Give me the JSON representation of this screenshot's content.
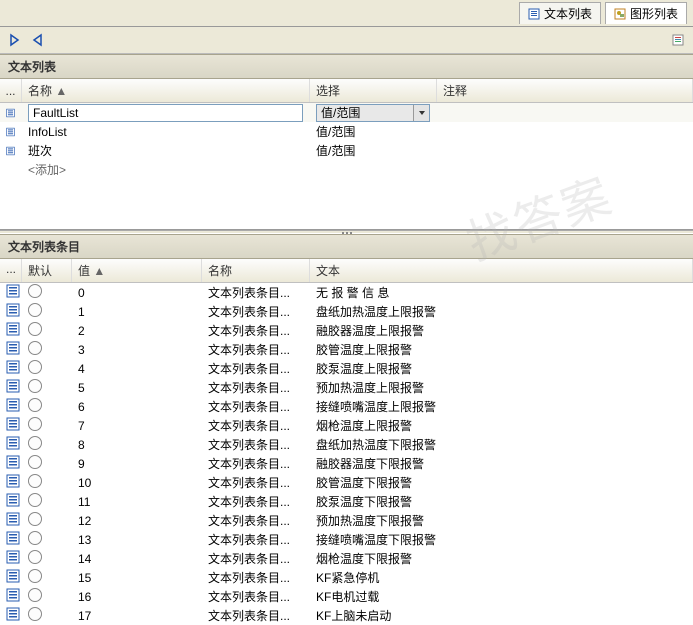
{
  "tabs": {
    "text_list": "文本列表",
    "graphic_list": "图形列表"
  },
  "section_list": {
    "title": "文本列表",
    "cols": {
      "name": "名称",
      "sel": "选择",
      "note": "注释"
    },
    "option": "值/范围",
    "rows": [
      {
        "name": "FaultList",
        "sel": "值/范围",
        "editing": true
      },
      {
        "name": "InfoList",
        "sel": "值/范围"
      },
      {
        "name": "班次",
        "sel": "值/范围"
      }
    ],
    "add": "<添加>"
  },
  "section_entries": {
    "title": "文本列表条目",
    "cols": {
      "def": "默认",
      "val": "值",
      "name": "名称",
      "text": "文本"
    },
    "rows": [
      {
        "val": "0",
        "name": "文本列表条目...",
        "text": "无  报  警  信  息"
      },
      {
        "val": "1",
        "name": "文本列表条目...",
        "text": "  盘纸加热温度上限报警"
      },
      {
        "val": "2",
        "name": "文本列表条目...",
        "text": "融胶器温度上限报警"
      },
      {
        "val": "3",
        "name": "文本列表条目...",
        "text": "胶管温度上限报警"
      },
      {
        "val": "4",
        "name": "文本列表条目...",
        "text": "胶泵温度上限报警"
      },
      {
        "val": "5",
        "name": "文本列表条目...",
        "text": "预加热温度上限报警"
      },
      {
        "val": "6",
        "name": "文本列表条目...",
        "text": "接缝喷嘴温度上限报警"
      },
      {
        "val": "7",
        "name": "文本列表条目...",
        "text": "烟枪温度上限报警"
      },
      {
        "val": "8",
        "name": "文本列表条目...",
        "text": "  盘纸加热温度下限报警"
      },
      {
        "val": "9",
        "name": "文本列表条目...",
        "text": "融胶器温度下限报警"
      },
      {
        "val": "10",
        "name": "文本列表条目...",
        "text": "胶管温度下限报警"
      },
      {
        "val": "11",
        "name": "文本列表条目...",
        "text": "胶泵温度下限报警"
      },
      {
        "val": "12",
        "name": "文本列表条目...",
        "text": "预加热温度下限报警"
      },
      {
        "val": "13",
        "name": "文本列表条目...",
        "text": "接缝喷嘴温度下限报警"
      },
      {
        "val": "14",
        "name": "文本列表条目...",
        "text": "烟枪温度下限报警"
      },
      {
        "val": "15",
        "name": "文本列表条目...",
        "text": "KF紧急停机"
      },
      {
        "val": "16",
        "name": "文本列表条目...",
        "text": "KF电机过载"
      },
      {
        "val": "17",
        "name": "文本列表条目...",
        "text": "KF上脑未启动"
      }
    ]
  },
  "watermark": "找答案"
}
